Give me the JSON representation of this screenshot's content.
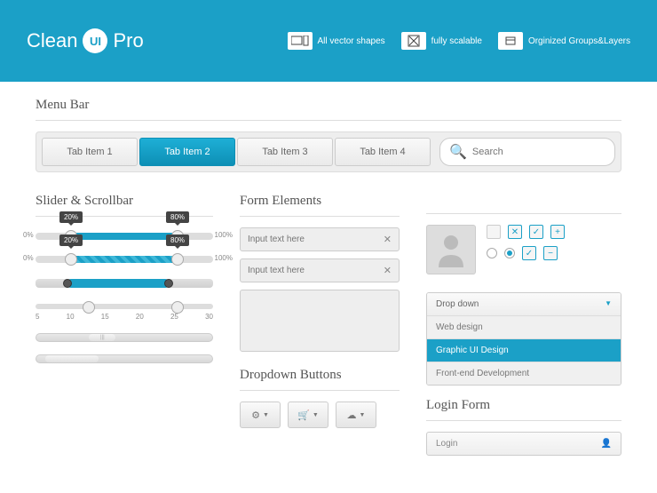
{
  "header": {
    "logo_pre": "Clean",
    "logo_badge": "UI",
    "logo_post": "Pro",
    "features": [
      {
        "label": "All vector shapes"
      },
      {
        "label": "fully scalable"
      },
      {
        "label": "Orginized Groups&Layers"
      }
    ]
  },
  "sections": {
    "menubar": "Menu Bar",
    "slider": "Slider & Scrollbar",
    "form": "Form Elements",
    "dropdown_btns": "Dropdown Buttons",
    "login": "Login Form"
  },
  "tabs": [
    "Tab Item 1",
    "Tab Item 2",
    "Tab Item 3",
    "Tab Item 4"
  ],
  "active_tab": 1,
  "search_placeholder": "Search",
  "sliders": {
    "s1": {
      "left_pct": "0%",
      "right_pct": "100%",
      "t1": "20%",
      "t2": "80%"
    },
    "s2": {
      "left_pct": "0%",
      "right_pct": "100%",
      "t1": "20%",
      "t2": "80%"
    },
    "ticks": [
      "5",
      "10",
      "15",
      "20",
      "25",
      "30"
    ]
  },
  "inputs": {
    "placeholder": "Input text here"
  },
  "dropdown": {
    "label": "Drop down",
    "items": [
      "Web design",
      "Graphic UI Design",
      "Front-end Development"
    ],
    "selected": 1
  },
  "login_field": "Login"
}
